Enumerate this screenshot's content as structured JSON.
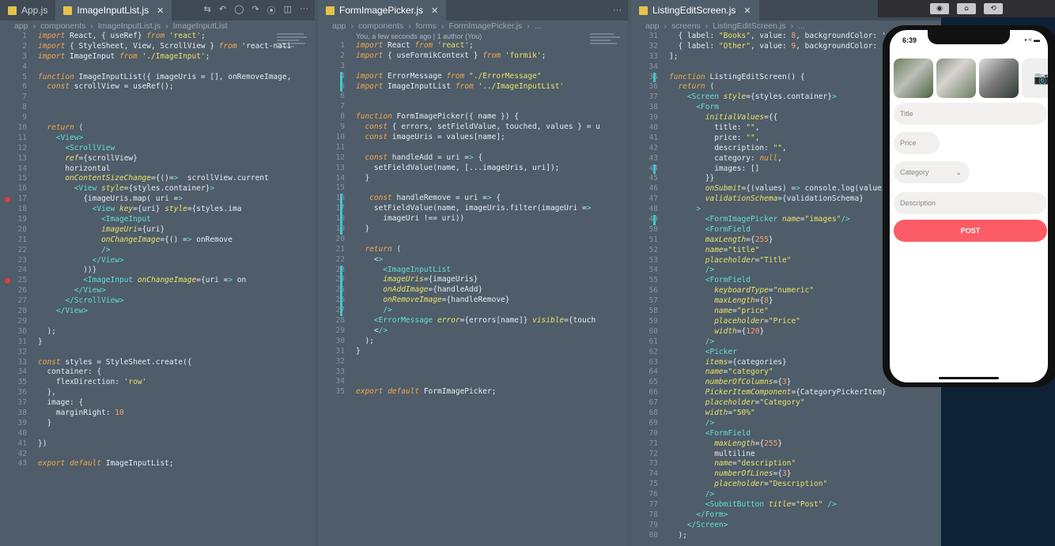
{
  "pane1": {
    "tabs": [
      {
        "label": "App.js"
      },
      {
        "label": "ImageInputList.js"
      }
    ],
    "crumbs": [
      "app",
      "components",
      "ImageInputList.js",
      "ImageInputList"
    ],
    "lines": [
      {
        "n": "1",
        "t": "import React, { useRef} from 'react';"
      },
      {
        "n": "2",
        "t": "import { StyleSheet, View, ScrollView } from 'react-nati"
      },
      {
        "n": "3",
        "t": "import ImageInput from './ImageInput';"
      },
      {
        "n": "4",
        "t": ""
      },
      {
        "n": "5",
        "t": "function ImageInputList({ imageUris = [], onRemoveImage,"
      },
      {
        "n": "6",
        "t": "  const scrollView = useRef();"
      },
      {
        "n": "7",
        "t": ""
      },
      {
        "n": "8",
        "t": ""
      },
      {
        "n": "9",
        "t": ""
      },
      {
        "n": "10",
        "t": "  return ("
      },
      {
        "n": "11",
        "t": "    <View>"
      },
      {
        "n": "12",
        "t": "      <ScrollView"
      },
      {
        "n": "13",
        "t": "      ref={scrollView}"
      },
      {
        "n": "14",
        "t": "      horizontal"
      },
      {
        "n": "15",
        "t": "      onContentSizeChange={()=>  scrollView.current"
      },
      {
        "n": "16",
        "t": "        <View style={styles.container}>"
      },
      {
        "n": "17",
        "t": "          {imageUris.map( uri =>"
      },
      {
        "n": "18",
        "t": "            <View key={uri} style={styles.ima"
      },
      {
        "n": "19",
        "t": "              <ImageInput"
      },
      {
        "n": "20",
        "t": "              imageUri={uri}"
      },
      {
        "n": "21",
        "t": "              onChangeImage={() => onRemove"
      },
      {
        "n": "22",
        "t": "              />"
      },
      {
        "n": "23",
        "t": "            </View>"
      },
      {
        "n": "24",
        "t": "          ))}"
      },
      {
        "n": "25",
        "t": "          <ImageInput onChangeImage={uri => on"
      },
      {
        "n": "26",
        "t": "        </View>"
      },
      {
        "n": "27",
        "t": "      </ScrollView>"
      },
      {
        "n": "28",
        "t": "    </View>"
      },
      {
        "n": "29",
        "t": ""
      },
      {
        "n": "30",
        "t": "  );"
      },
      {
        "n": "31",
        "t": "}"
      },
      {
        "n": "32",
        "t": ""
      },
      {
        "n": "33",
        "t": "const styles = StyleSheet.create({"
      },
      {
        "n": "34",
        "t": "  container: {"
      },
      {
        "n": "35",
        "t": "    flexDirection: 'row'"
      },
      {
        "n": "36",
        "t": "  },"
      },
      {
        "n": "37",
        "t": "  image: {"
      },
      {
        "n": "38",
        "t": "    marginRight: 10"
      },
      {
        "n": "39",
        "t": "  }"
      },
      {
        "n": "40",
        "t": ""
      },
      {
        "n": "41",
        "t": "})"
      },
      {
        "n": "42",
        "t": ""
      },
      {
        "n": "43",
        "t": "export default ImageInputList;"
      }
    ]
  },
  "pane2": {
    "tabs": [
      {
        "label": "FormImagePicker.js"
      }
    ],
    "crumbs": [
      "app",
      "components",
      "forms",
      "FormImagePicker.js",
      "..."
    ],
    "blame": "You, a few seconds ago | 1 author (You)",
    "lines": [
      {
        "n": "1",
        "t": "import React from 'react';"
      },
      {
        "n": "2",
        "t": "import { useFormikContext } from 'formik';"
      },
      {
        "n": "3",
        "t": ""
      },
      {
        "n": "4",
        "t": "import ErrorMessage from \"./ErrorMessage\""
      },
      {
        "n": "5",
        "t": "import ImageInputList from '../ImageInputList'"
      },
      {
        "n": "6",
        "t": ""
      },
      {
        "n": "7",
        "t": ""
      },
      {
        "n": "8",
        "t": "function FormImagePicker({ name }) {"
      },
      {
        "n": "9",
        "t": "  const { errors, setFieldValue, touched, values } = u"
      },
      {
        "n": "10",
        "t": "  const imageUris = values[name];"
      },
      {
        "n": "11",
        "t": ""
      },
      {
        "n": "12",
        "t": "  const handleAdd = uri => {"
      },
      {
        "n": "13",
        "t": "    setFieldValue(name, [...imageUris, uri]);"
      },
      {
        "n": "14",
        "t": "  }"
      },
      {
        "n": "15",
        "t": ""
      },
      {
        "n": "16",
        "t": "   const handleRemove = uri => {"
      },
      {
        "n": "17",
        "t": "    setFieldValue(name, imageUris.filter(imageUri =>"
      },
      {
        "n": "18",
        "t": "      imageUri !== uri))"
      },
      {
        "n": "19",
        "t": "  }"
      },
      {
        "n": "20",
        "t": ""
      },
      {
        "n": "21",
        "t": "  return ("
      },
      {
        "n": "22",
        "t": "    <>"
      },
      {
        "n": "23",
        "t": "      <ImageInputList"
      },
      {
        "n": "24",
        "t": "      imageUris={imageUris}"
      },
      {
        "n": "25",
        "t": "      onAddImage={handleAdd}"
      },
      {
        "n": "26",
        "t": "      onRemoveImage={handleRemove}"
      },
      {
        "n": "27",
        "t": "      />"
      },
      {
        "n": "28",
        "t": "    <ErrorMessage error={errors[name]} visible={touch"
      },
      {
        "n": "29",
        "t": "    </>"
      },
      {
        "n": "30",
        "t": "  );"
      },
      {
        "n": "31",
        "t": "}"
      },
      {
        "n": "32",
        "t": ""
      },
      {
        "n": "33",
        "t": ""
      },
      {
        "n": "34",
        "t": ""
      },
      {
        "n": "35",
        "t": "export default FormImagePicker;"
      }
    ]
  },
  "pane3": {
    "tabs": [
      {
        "label": "ListingEditScreen.js"
      }
    ],
    "crumbs": [
      "app",
      "screens",
      "ListingEditScreen.js",
      "..."
    ],
    "lines": [
      {
        "n": "31",
        "t": "  { label: \"Books\", value: 8, backgroundColor: 'greer"
      },
      {
        "n": "32",
        "t": "  { label: \"Other\", value: 9, backgroundColor: 'grey'"
      },
      {
        "n": "33",
        "t": "];"
      },
      {
        "n": "34",
        "t": ""
      },
      {
        "n": "35",
        "t": "function ListingEditScreen() {"
      },
      {
        "n": "36",
        "t": "  return ("
      },
      {
        "n": "37",
        "t": "    <Screen style={styles.container}>"
      },
      {
        "n": "38",
        "t": "      <Form"
      },
      {
        "n": "39",
        "t": "        initialValues={{"
      },
      {
        "n": "40",
        "t": "          title: \"\","
      },
      {
        "n": "41",
        "t": "          price: \"\","
      },
      {
        "n": "42",
        "t": "          description: \"\","
      },
      {
        "n": "43",
        "t": "          category: null,"
      },
      {
        "n": "44",
        "t": "          images: []"
      },
      {
        "n": "45",
        "t": "        }}"
      },
      {
        "n": "46",
        "t": "        onSubmit={(values) => console.log(values)}"
      },
      {
        "n": "47",
        "t": "        validationSchema={validationSchema}"
      },
      {
        "n": "48",
        "t": "      >"
      },
      {
        "n": "49",
        "t": "        <FormImagePicker name=\"images\"/>"
      },
      {
        "n": "50",
        "t": "        <FormField"
      },
      {
        "n": "51",
        "t": "        maxLength={255}"
      },
      {
        "n": "52",
        "t": "        name=\"title\""
      },
      {
        "n": "53",
        "t": "        placeholder=\"Title\""
      },
      {
        "n": "54",
        "t": "        />"
      },
      {
        "n": "55",
        "t": "        <FormField"
      },
      {
        "n": "56",
        "t": "          keyboardType=\"numeric\""
      },
      {
        "n": "57",
        "t": "          maxLength={8}"
      },
      {
        "n": "58",
        "t": "          name=\"price\""
      },
      {
        "n": "59",
        "t": "          placeholder=\"Price\""
      },
      {
        "n": "60",
        "t": "          width={120}"
      },
      {
        "n": "61",
        "t": "        />"
      },
      {
        "n": "62",
        "t": "        <Picker"
      },
      {
        "n": "63",
        "t": "        items={categories}"
      },
      {
        "n": "64",
        "t": "        name=\"category\""
      },
      {
        "n": "65",
        "t": "        numberOfColumns={3}"
      },
      {
        "n": "66",
        "t": "        PickerItemComponent={CategoryPickerItem}"
      },
      {
        "n": "67",
        "t": "        placeholder=\"Category\""
      },
      {
        "n": "68",
        "t": "        width=\"50%\""
      },
      {
        "n": "69",
        "t": "        />"
      },
      {
        "n": "70",
        "t": "        <FormField"
      },
      {
        "n": "71",
        "t": "          maxLength={255}"
      },
      {
        "n": "72",
        "t": "          multiline"
      },
      {
        "n": "73",
        "t": "          name=\"description\""
      },
      {
        "n": "74",
        "t": "          numberOfLines={3}"
      },
      {
        "n": "75",
        "t": "          placeholder=\"Description\""
      },
      {
        "n": "76",
        "t": "        />"
      },
      {
        "n": "77",
        "t": "        <SubmitButton title=\"Post\" />"
      },
      {
        "n": "78",
        "t": "      </Form>"
      },
      {
        "n": "79",
        "t": "    </Screen>"
      },
      {
        "n": "80",
        "t": "  );"
      }
    ]
  },
  "phone": {
    "time": "6:39",
    "title_placeholder": "Title",
    "price_placeholder": "Price",
    "category_placeholder": "Category",
    "description_placeholder": "Description",
    "post_label": "POST"
  }
}
